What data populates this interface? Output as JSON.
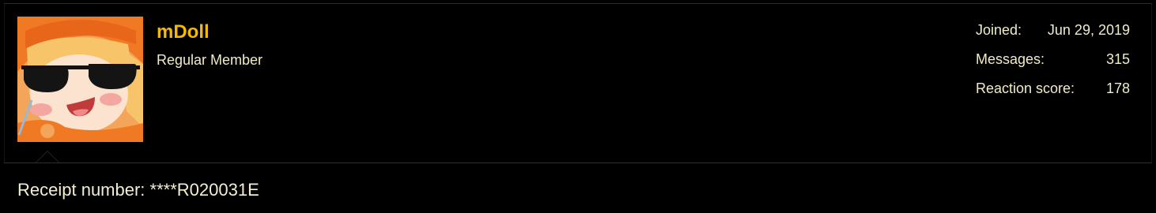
{
  "user": {
    "name": "mDoll",
    "title": "Regular Member",
    "avatar_icon": "anime-girl-sunglasses-avatar"
  },
  "stats": {
    "joined_label": "Joined:",
    "joined_value": "Jun 29, 2019",
    "messages_label": "Messages:",
    "messages_value": "315",
    "reaction_label": "Reaction score:",
    "reaction_value": "178"
  },
  "post": {
    "body": "Receipt number: ****R020031E"
  },
  "colors": {
    "background": "#000000",
    "username": "#f6b800",
    "text": "#f0ecc8",
    "divider": "#2e2e2e"
  }
}
